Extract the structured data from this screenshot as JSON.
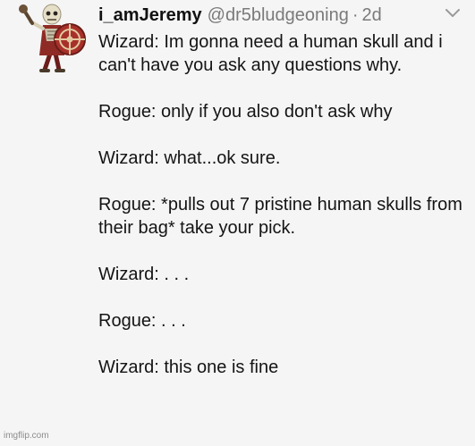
{
  "tweet": {
    "display_name": "i_amJeremy",
    "handle": "@dr5bludgeoning",
    "separator": "·",
    "timestamp": "2d",
    "avatar_icon": "skeleton-warrior-icon",
    "menu_icon": "chevron-down-icon",
    "paragraphs": [
      "Wizard: Im gonna need a human skull and i can't have you ask any questions why.",
      "Rogue: only if you also don't ask why",
      "Wizard: what...ok sure.",
      "Rogue: *pulls out 7 pristine human skulls from their bag* take your pick.",
      "Wizard: . . .",
      "Rogue: . . .",
      "Wizard: this one is fine"
    ]
  },
  "watermark": "imgflip.com",
  "colors": {
    "background": "#f5f5f5",
    "text": "#141414",
    "muted": "#7a7a7a",
    "shield_red": "#a8302a"
  }
}
